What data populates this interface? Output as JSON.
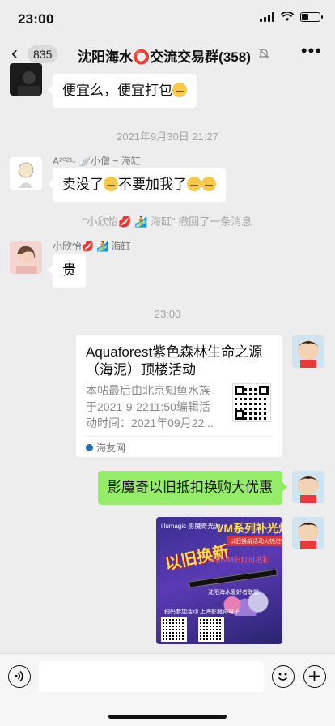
{
  "status": {
    "time": "23:00"
  },
  "nav": {
    "back_count": "835",
    "title": "沈阳海水⭕交流交易群(358)"
  },
  "messages": {
    "m1_text": "便宜么，便宜打包",
    "ts1": "2021年9月30日 21:27",
    "m2_sender": "A²⁰²¹- 🪽小僧 ~ 海缸",
    "m2_text_a": "卖没了",
    "m2_text_b": "不要加我了",
    "recall": "\"小欣怡💋 🏄 海缸\" 撤回了一条消息",
    "m3_sender": "小欣怡💋 🏄 海缸",
    "m3_text": "贵",
    "ts2": "23:00",
    "card": {
      "title": "Aquaforest紫色森林生命之源（海泥）顶楼活动",
      "desc_line1": "本帖最后由北京知鱼水族",
      "desc_line2": "于2021-9-2211:50编辑活",
      "desc_line3": "动时间：2021年09月22...",
      "source": "海友网"
    },
    "m4_text": "影魔奇以旧抵扣换购大优惠",
    "image": {
      "brand": "illumagic 影魔奇光源",
      "title": "VM系列补光灯",
      "sub": "以旧换新活动火热进行中",
      "promo": "以旧换新",
      "red_text": "买新VM旧灯可抵扣",
      "line1": "沈阳海水爱好者联盟",
      "line2": "扫码参加活动 上海影魔奇电子"
    }
  },
  "colors": {
    "background": "#ededed",
    "bubble_self": "#95ec69",
    "bubble_other": "#ffffff"
  }
}
